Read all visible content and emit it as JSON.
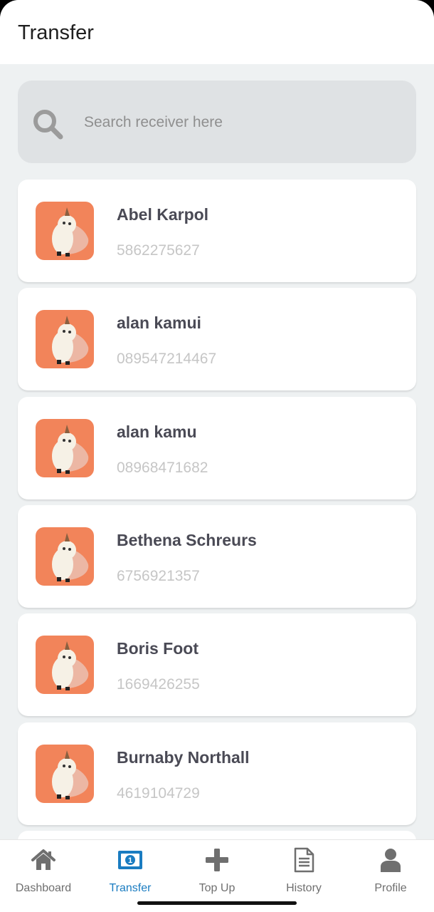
{
  "header": {
    "title": "Transfer"
  },
  "search": {
    "placeholder": "Search receiver here",
    "icon": "search-icon"
  },
  "receivers": [
    {
      "name": "Abel Karpol",
      "phone": "5862275627"
    },
    {
      "name": "alan kamui",
      "phone": "089547214467"
    },
    {
      "name": "alan kamu",
      "phone": "08968471682"
    },
    {
      "name": "Bethena Schreurs",
      "phone": "6756921357"
    },
    {
      "name": "Boris Foot",
      "phone": "1669426255"
    },
    {
      "name": "Burnaby Northall",
      "phone": "4619104729"
    }
  ],
  "nav": {
    "items": [
      {
        "label": "Dashboard",
        "icon": "home-icon"
      },
      {
        "label": "Transfer",
        "icon": "money-icon",
        "active": true
      },
      {
        "label": "Top Up",
        "icon": "plus-icon"
      },
      {
        "label": "History",
        "icon": "document-icon"
      },
      {
        "label": "Profile",
        "icon": "user-icon"
      }
    ]
  },
  "colors": {
    "accent": "#1a7cc1",
    "avatar_bg": "#f2845a",
    "background": "#eef1f2"
  }
}
